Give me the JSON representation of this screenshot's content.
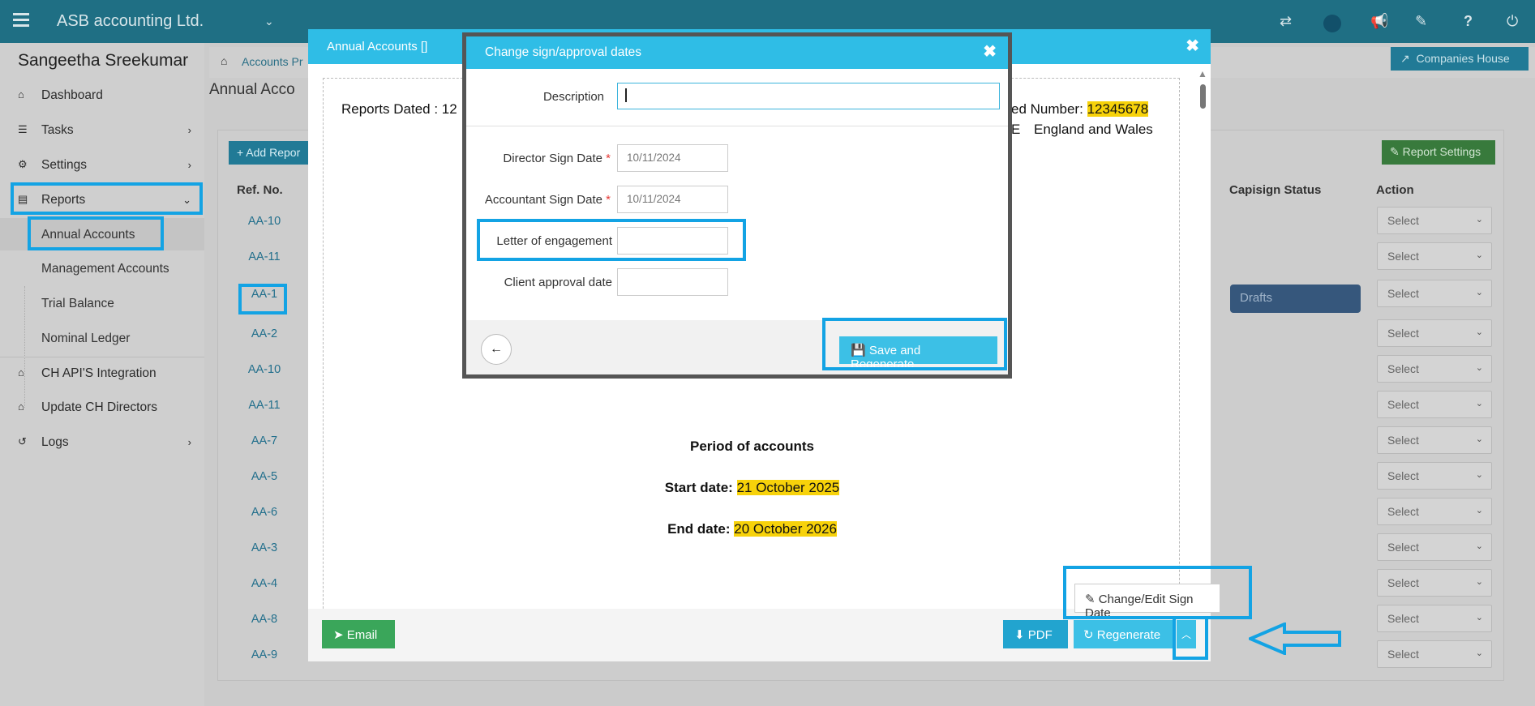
{
  "topbar": {
    "app_title": "ASB accounting Ltd.",
    "icons": [
      "exchange-icon",
      "c-logo-icon",
      "megaphone-icon",
      "tag-icon",
      "help-icon",
      "power-icon"
    ]
  },
  "sidebar": {
    "user": "Sangeetha Sreekumar",
    "items": [
      {
        "label": "Dashboard",
        "icon": "home-icon"
      },
      {
        "label": "Tasks",
        "icon": "tasks-icon"
      },
      {
        "label": "Settings",
        "icon": "gear-icon"
      },
      {
        "label": "Reports",
        "icon": "file-icon"
      },
      {
        "label": "CH API'S Integration",
        "icon": "home-icon"
      },
      {
        "label": "Update CH Directors",
        "icon": "home-icon"
      },
      {
        "label": "Logs",
        "icon": "history-icon"
      }
    ],
    "sub_items": [
      "Annual Accounts",
      "Management Accounts",
      "Trial Balance",
      "Nominal Ledger"
    ]
  },
  "page": {
    "breadcrumb": "Accounts Pr",
    "heading": "Annual Acco",
    "add_button": "Add Repor",
    "companies_house": "Companies House",
    "report_settings": "Report Settings",
    "col_ref": "Ref. No.",
    "col_capisign": "Capisign Status",
    "col_action": "Action",
    "ref_numbers": [
      "AA-10",
      "AA-11",
      "AA-1",
      "AA-2",
      "AA-10",
      "AA-11",
      "AA-7",
      "AA-5",
      "AA-6",
      "AA-3",
      "AA-4",
      "AA-8",
      "AA-9"
    ],
    "select_label": "Select",
    "drafts_badge": "Drafts"
  },
  "outer_modal": {
    "title": "Annual Accounts []",
    "reports_dated": "Reports Dated : 12",
    "reg_number_label": "ed Number:",
    "reg_number": "12345678",
    "jurisdiction_prefix": "E",
    "jurisdiction": "England and Wales",
    "period_heading": "Period of accounts",
    "start_label": "Start date:",
    "start_date": "21 October 2025",
    "end_label": "End date:",
    "end_date": "20 October 2026",
    "email": "Email",
    "pdf": "PDF",
    "regenerate": "Regenerate",
    "dropdown_item": "Change/Edit Sign Date"
  },
  "inner_modal": {
    "title": "Change sign/approval dates",
    "description_label": "Description",
    "description_value": "",
    "director_sign_label": "Director Sign Date",
    "director_sign_value": "10/11/2024",
    "accountant_sign_label": "Accountant Sign Date",
    "accountant_sign_value": "10/11/2024",
    "engagement_label": "Letter of engagement",
    "engagement_value": "",
    "client_approval_label": "Client approval date",
    "client_approval_value": "",
    "save_button": "Save and Regenerate"
  },
  "colors": {
    "topbar": "#1f6f84",
    "modal_header": "#2fbde6",
    "highlight": "#13a3e4",
    "email_green": "#3aa65a",
    "date_highlight": "#f7d20a"
  }
}
